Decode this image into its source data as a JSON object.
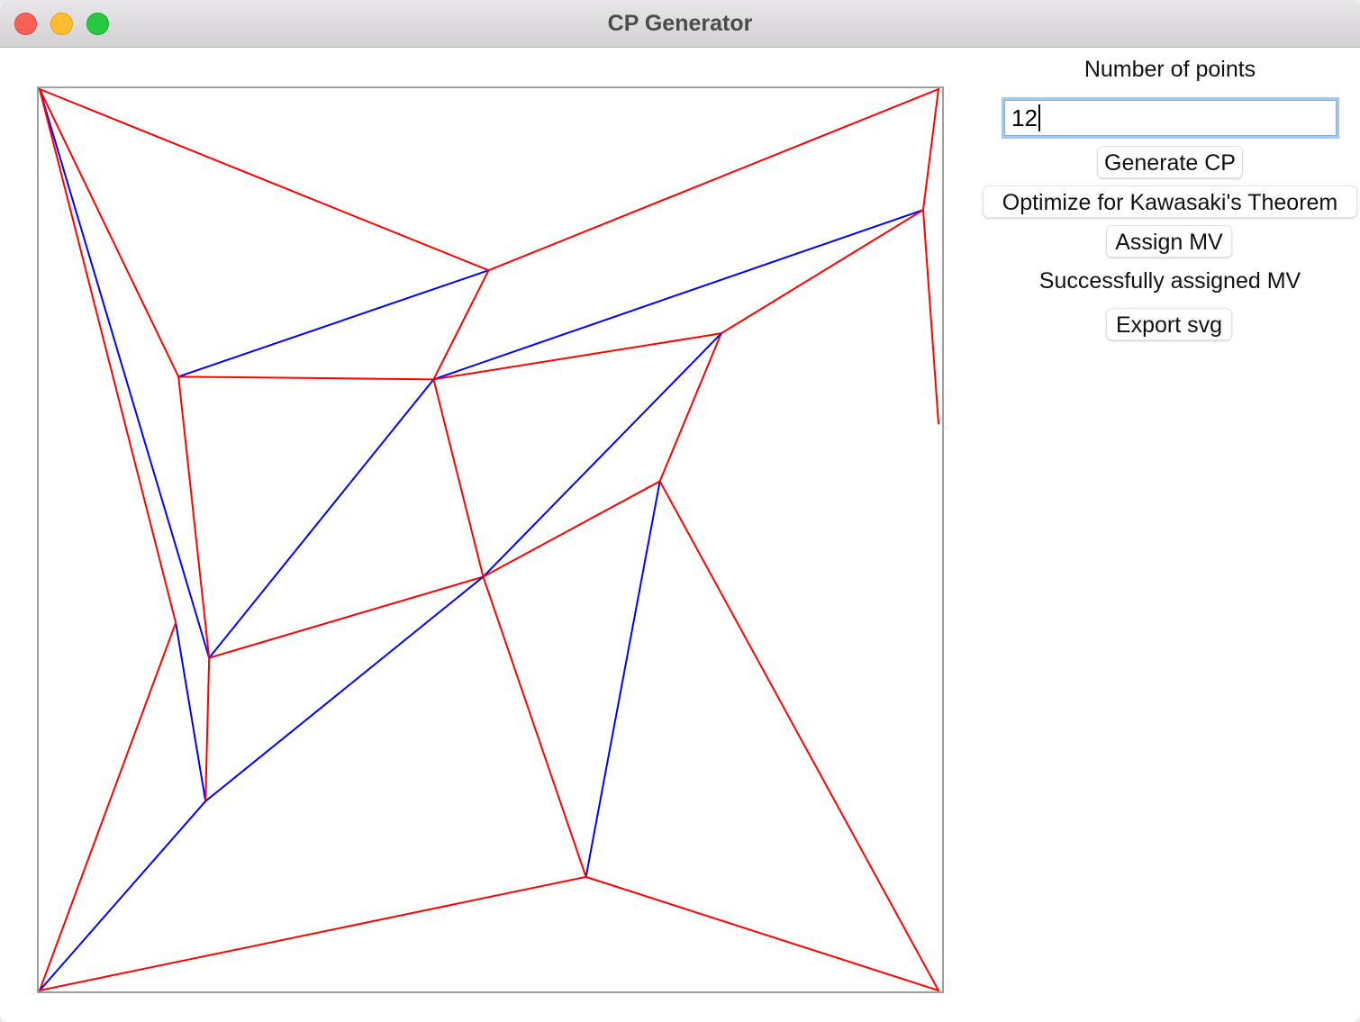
{
  "window": {
    "title": "CP Generator"
  },
  "controls": {
    "points_label": "Number of points",
    "points_value": "12",
    "generate_label": "Generate CP",
    "optimize_label": "Optimize for Kawasaki's Theorem",
    "assign_label": "Assign MV",
    "status_text": "Successfully assigned MV",
    "export_label": "Export svg"
  },
  "colors": {
    "mountain": "#ff0000",
    "valley": "#0000ff",
    "traffic_close": "#fe5f57",
    "traffic_minimize": "#febc2e",
    "traffic_zoom": "#28c840"
  },
  "crease_pattern": {
    "vertices": [
      [
        0.0,
        0.0
      ],
      [
        0.498,
        0.201
      ],
      [
        0.997,
        0.0
      ],
      [
        0.98,
        0.134
      ],
      [
        0.154,
        0.319
      ],
      [
        0.437,
        0.322
      ],
      [
        0.756,
        0.271
      ],
      [
        0.997,
        0.371
      ],
      [
        0.688,
        0.435
      ],
      [
        0.492,
        0.541
      ],
      [
        0.151,
        0.592
      ],
      [
        0.188,
        0.631
      ],
      [
        0.184,
        0.79
      ],
      [
        0.606,
        0.874
      ],
      [
        0.0,
        1.0
      ],
      [
        0.997,
        1.0
      ]
    ],
    "creases": [
      {
        "from": 0,
        "to": 1,
        "type": "mountain"
      },
      {
        "from": 1,
        "to": 2,
        "type": "mountain"
      },
      {
        "from": 0,
        "to": 4,
        "type": "mountain"
      },
      {
        "from": 0,
        "to": 11,
        "type": "valley"
      },
      {
        "from": 0,
        "to": 10,
        "type": "mountain"
      },
      {
        "from": 4,
        "to": 1,
        "type": "valley"
      },
      {
        "from": 4,
        "to": 5,
        "type": "mountain"
      },
      {
        "from": 4,
        "to": 11,
        "type": "mountain"
      },
      {
        "from": 1,
        "to": 5,
        "type": "mountain"
      },
      {
        "from": 5,
        "to": 3,
        "type": "valley"
      },
      {
        "from": 5,
        "to": 6,
        "type": "mountain"
      },
      {
        "from": 5,
        "to": 11,
        "type": "valley"
      },
      {
        "from": 5,
        "to": 9,
        "type": "mountain"
      },
      {
        "from": 2,
        "to": 3,
        "type": "mountain"
      },
      {
        "from": 3,
        "to": 7,
        "type": "mountain"
      },
      {
        "from": 3,
        "to": 6,
        "type": "mountain"
      },
      {
        "from": 6,
        "to": 8,
        "type": "mountain"
      },
      {
        "from": 6,
        "to": 9,
        "type": "valley"
      },
      {
        "from": 8,
        "to": 9,
        "type": "mountain"
      },
      {
        "from": 8,
        "to": 13,
        "type": "valley"
      },
      {
        "from": 8,
        "to": 15,
        "type": "mountain"
      },
      {
        "from": 9,
        "to": 11,
        "type": "mountain"
      },
      {
        "from": 9,
        "to": 12,
        "type": "valley"
      },
      {
        "from": 9,
        "to": 13,
        "type": "mountain"
      },
      {
        "from": 10,
        "to": 12,
        "type": "valley"
      },
      {
        "from": 10,
        "to": 14,
        "type": "mountain"
      },
      {
        "from": 11,
        "to": 12,
        "type": "mountain"
      },
      {
        "from": 12,
        "to": 14,
        "type": "valley"
      },
      {
        "from": 13,
        "to": 14,
        "type": "mountain"
      },
      {
        "from": 13,
        "to": 15,
        "type": "mountain"
      }
    ]
  }
}
